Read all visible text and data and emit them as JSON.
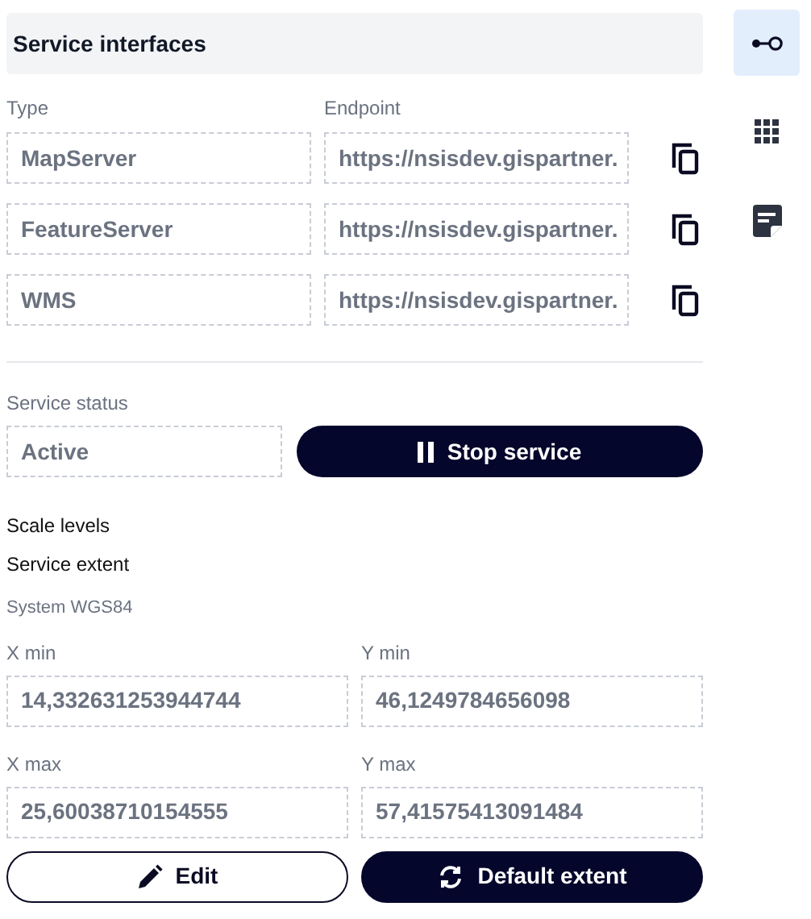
{
  "section_title": "Service interfaces",
  "interfaces": {
    "columns": [
      "Type",
      "Endpoint"
    ],
    "rows": [
      {
        "type": "MapServer",
        "endpoint": "https://nsisdev.gispartner."
      },
      {
        "type": "FeatureServer",
        "endpoint": "https://nsisdev.gispartner."
      },
      {
        "type": "WMS",
        "endpoint": "https://nsisdev.gispartner."
      }
    ]
  },
  "service_status": {
    "label": "Service status",
    "value": "Active",
    "button": "Stop service"
  },
  "scale_levels": "Scale levels",
  "service_extent": {
    "title": "Service extent",
    "system": "System WGS84",
    "fields": [
      {
        "label": "X min",
        "value": "14,332631253944744"
      },
      {
        "label": "Y min",
        "value": "46,1249784656098"
      },
      {
        "label": "X max",
        "value": "25,60038710154555"
      },
      {
        "label": "Y max",
        "value": "57,41575413091484"
      }
    ]
  },
  "buttons": [
    {
      "label": "Edit",
      "kind": "outline"
    },
    {
      "label": "Default extent",
      "kind": "filled"
    }
  ],
  "sidebar": [
    {
      "kind": "interfaces",
      "selected": true
    },
    {
      "kind": "grid",
      "selected": false
    },
    {
      "kind": "note",
      "selected": false
    }
  ]
}
